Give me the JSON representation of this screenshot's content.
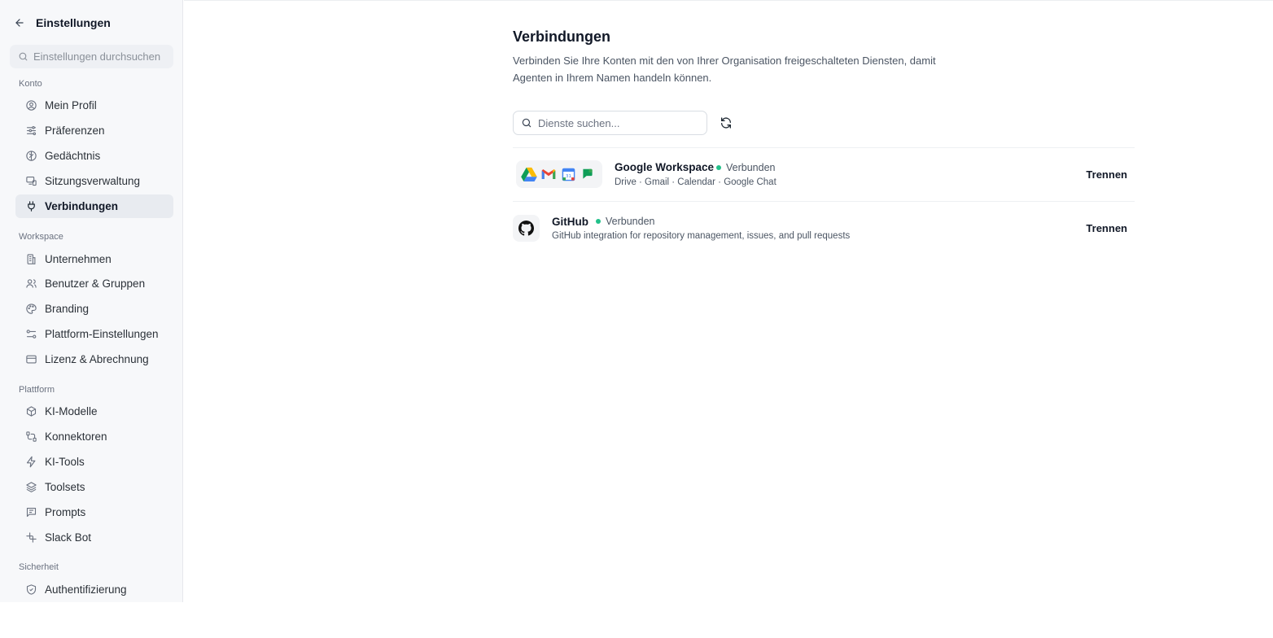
{
  "sidebar": {
    "title": "Einstellungen",
    "search_placeholder": "Einstellungen durchsuchen",
    "sections": [
      {
        "label": "Konto",
        "items": [
          {
            "label": "Mein Profil",
            "icon": "user-circle-icon"
          },
          {
            "label": "Präferenzen",
            "icon": "sliders-icon"
          },
          {
            "label": "Gedächtnis",
            "icon": "brain-icon"
          },
          {
            "label": "Sitzungsverwaltung",
            "icon": "devices-icon"
          },
          {
            "label": "Verbindungen",
            "icon": "plug-icon",
            "active": true
          }
        ]
      },
      {
        "label": "Workspace",
        "items": [
          {
            "label": "Unternehmen",
            "icon": "building-icon"
          },
          {
            "label": "Benutzer & Gruppen",
            "icon": "users-icon"
          },
          {
            "label": "Branding",
            "icon": "palette-icon"
          },
          {
            "label": "Plattform-Einstellungen",
            "icon": "settings-toggle-icon"
          },
          {
            "label": "Lizenz & Abrechnung",
            "icon": "credit-card-icon"
          }
        ]
      },
      {
        "label": "Plattform",
        "items": [
          {
            "label": "KI-Modelle",
            "icon": "cube-icon"
          },
          {
            "label": "Konnektoren",
            "icon": "cable-icon"
          },
          {
            "label": "KI-Tools",
            "icon": "zap-icon"
          },
          {
            "label": "Toolsets",
            "icon": "layers-icon"
          },
          {
            "label": "Prompts",
            "icon": "message-square-icon"
          },
          {
            "label": "Slack Bot",
            "icon": "slack-icon"
          }
        ]
      },
      {
        "label": "Sicherheit",
        "items": [
          {
            "label": "Authentifizierung",
            "icon": "shield-check-icon"
          }
        ]
      }
    ]
  },
  "main": {
    "title": "Verbindungen",
    "description": "Verbinden Sie Ihre Konten mit den von Ihrer Organisation freigeschalteten Diensten, damit Agenten in Ihrem Namen handeln können.",
    "search_placeholder": "Dienste suchen...",
    "connections": [
      {
        "name": "Google Workspace",
        "status": "Verbunden",
        "description": "Drive · Gmail · Calendar · Google Chat",
        "action": "Trennen",
        "icons": [
          "google-drive-icon",
          "gmail-icon",
          "google-calendar-icon",
          "google-chat-icon"
        ]
      },
      {
        "name": "GitHub",
        "status": "Verbunden",
        "description": "GitHub integration for repository management, issues, and pull requests",
        "action": "Trennen",
        "icons": [
          "github-icon"
        ]
      }
    ]
  },
  "colors": {
    "status_green": "#22c08a",
    "active_nav_bg": "#e8ebf0",
    "sidebar_bg": "#f7f8fa"
  }
}
